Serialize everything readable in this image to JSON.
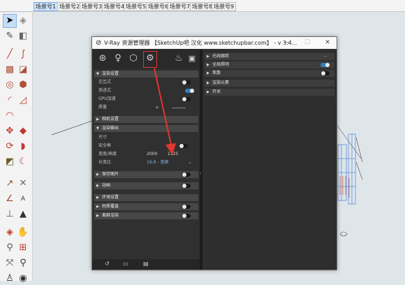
{
  "scene_tabs": [
    "场景号1",
    "场景号2",
    "场景号3",
    "场景号4",
    "场景号5",
    "场景号6",
    "场景号7",
    "场景号8",
    "场景号9"
  ],
  "vray": {
    "title": "V-Ray 资源管理器 【SketchUp吧 汉化 www.sketchupbar.com】 - v 3.4...",
    "window_buttons": [
      "—",
      "☐",
      "✕"
    ],
    "icon_names": [
      "materials-icon",
      "lights-icon",
      "geometry-icon",
      "settings-icon",
      "render-teapot-icon",
      "frame-buffer-icon"
    ],
    "sections": {
      "render": {
        "label": "渲染设置",
        "rows": [
          {
            "label": "交互式",
            "toggle": false
          },
          {
            "label": "渐进式",
            "toggle": true
          },
          {
            "label": "GPU加速",
            "toggle": false
          },
          {
            "label": "质量",
            "toggle": null
          }
        ]
      },
      "camera": {
        "label": "相机设置"
      },
      "output": {
        "label": "渲染输出",
        "size_label": "尺寸",
        "safe_frame": "安全框",
        "width_height_label": "宽度/高度",
        "width": "2000",
        "height": "1125",
        "aspect_label": "长宽比",
        "aspect_value": "16:9 - 宽屏"
      },
      "save_image": {
        "label": "保存图片"
      },
      "animation": {
        "label": "动画"
      },
      "environment": {
        "label": "环境设置"
      },
      "material_override": {
        "label": "材质覆盖"
      },
      "swarm": {
        "label": "离群渲染"
      }
    },
    "right_rows": [
      {
        "label": "光线跟踪",
        "toggle": null
      },
      {
        "label": "全局照明",
        "toggle": true
      },
      {
        "label": "焦散",
        "toggle": false
      },
      {
        "label": "渲染元素",
        "toggle": null
      },
      {
        "label": "开关",
        "toggle": null
      }
    ]
  }
}
